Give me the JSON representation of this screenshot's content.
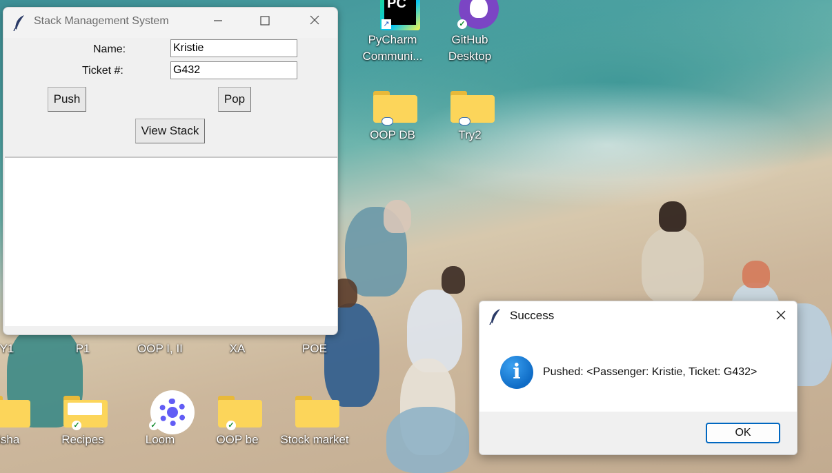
{
  "desktop": {
    "icons_top": [
      {
        "label_line1": "PyCharm",
        "label_line2": "Communi..."
      },
      {
        "label_line1": "GitHub",
        "label_line2": "Desktop"
      }
    ],
    "icons_mid": [
      {
        "label": "OOP DB"
      },
      {
        "label": "Try2"
      }
    ],
    "icons_row3": [
      {
        "label": "Y1"
      },
      {
        "label": "P1"
      },
      {
        "label": "OOP I, II"
      },
      {
        "label": "XA"
      },
      {
        "label": "POE"
      }
    ],
    "icons_bottom": [
      {
        "label": "aisha"
      },
      {
        "label": "Recipes"
      },
      {
        "label": "Loom"
      },
      {
        "label": "OOP be"
      },
      {
        "label": "Stock market"
      }
    ]
  },
  "app": {
    "title": "Stack Management System",
    "name_label": "Name:",
    "name_value": "Kristie",
    "ticket_label": "Ticket #:",
    "ticket_value": "G432",
    "push_label": "Push",
    "pop_label": "Pop",
    "view_label": "View Stack"
  },
  "dialog": {
    "title": "Success",
    "message": "Pushed: <Passenger: Kristie, Ticket: G432>",
    "ok_label": "OK"
  }
}
